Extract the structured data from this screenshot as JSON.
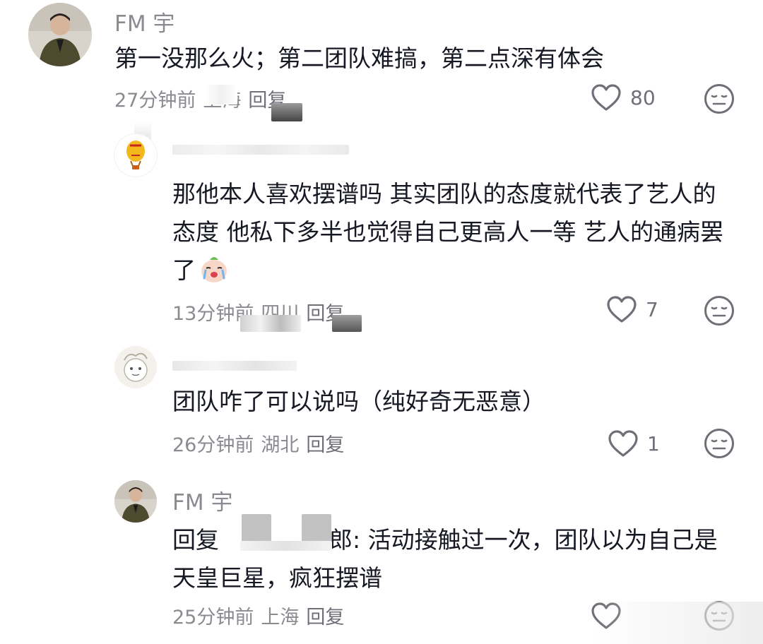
{
  "comments": [
    {
      "username": "FM 宇",
      "text": "第一没那么火；第二团队难搞，第二点深有体会",
      "time": "27分钟前",
      "location": "上海",
      "reply_label": "回复",
      "likes": "80",
      "avatar_icon": "user-photo-avatar"
    },
    {
      "username": "",
      "text": "那他本人喜欢摆谱吗 其实团队的态度就代表了艺人的态度 他私下多半也觉得自己更高人一等 艺人的通病罢了",
      "emoji": "crying-emoji",
      "time": "13分钟前",
      "location": "四川",
      "reply_label": "回复",
      "likes": "7",
      "avatar_icon": "hot-air-balloon-avatar"
    },
    {
      "username": "",
      "text": "团队咋了可以说吗（纯好奇无恶意）",
      "time": "26分钟前",
      "location": "湖北",
      "reply_label": "回复",
      "likes": "1",
      "avatar_icon": "cartoon-avatar"
    },
    {
      "username": "FM 宇",
      "reply_prefix": "回复",
      "reply_suffix": "郎",
      "text": ": 活动接触过一次，团队以为自己是天皇巨星，疯狂摆谱",
      "time": "25分钟前",
      "location": "上海",
      "reply_label": "回复",
      "likes": "",
      "avatar_icon": "user-photo-avatar"
    }
  ],
  "colors": {
    "text": "#161823",
    "meta": "#8a8b91",
    "icon": "#6f7077"
  }
}
